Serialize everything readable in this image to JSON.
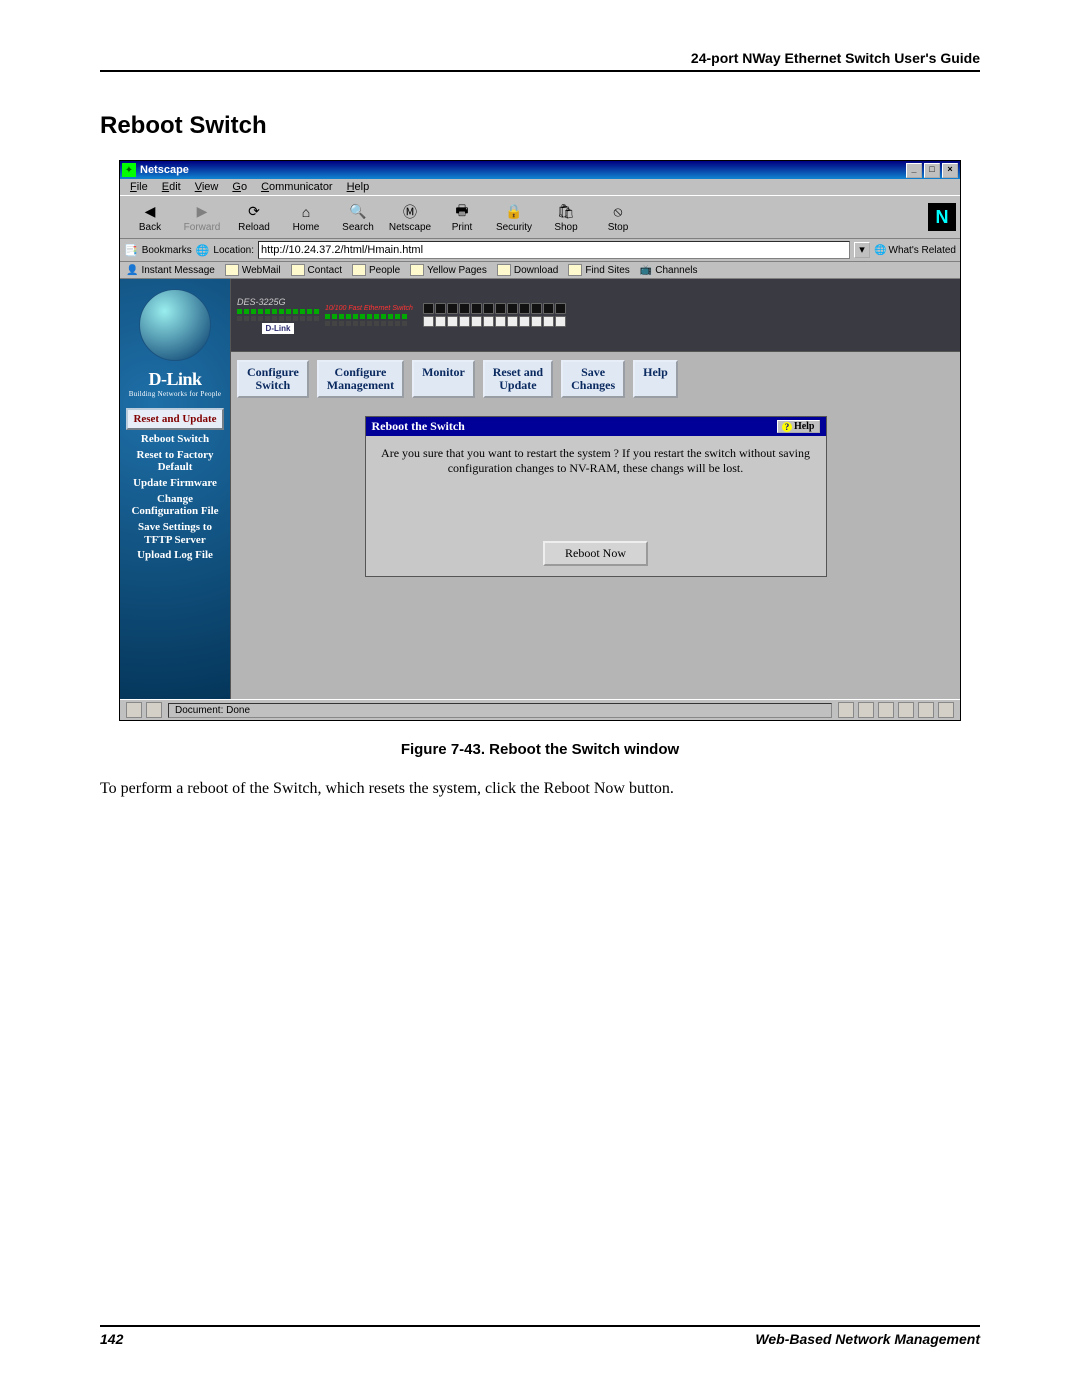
{
  "page_header": "24-port NWay Ethernet Switch User's Guide",
  "section_title": "Reboot Switch",
  "browser": {
    "title": "Netscape",
    "menu": [
      "File",
      "Edit",
      "View",
      "Go",
      "Communicator",
      "Help"
    ],
    "toolbar": {
      "back": "Back",
      "forward": "Forward",
      "reload": "Reload",
      "home": "Home",
      "search": "Search",
      "netscape": "Netscape",
      "print": "Print",
      "security": "Security",
      "shop": "Shop",
      "stop": "Stop"
    },
    "bookmarks_label": "Bookmarks",
    "location_label": "Location:",
    "location": "http://10.24.37.2/html/Hmain.html",
    "whats_related": "What's Related",
    "personal_toolbar": [
      "Instant Message",
      "WebMail",
      "Contact",
      "People",
      "Yellow Pages",
      "Download",
      "Find Sites",
      "Channels"
    ],
    "status": "Document: Done"
  },
  "device": {
    "model": "DES-3225G",
    "brand": "D-Link",
    "strip": "10/100 Fast Ethernet Switch"
  },
  "sidebar": {
    "brand": "D-Link",
    "tagline": "Building Networks for People",
    "active_btn": "Reset and Update",
    "links": [
      "Reboot Switch",
      "Reset to Factory Default",
      "Update Firmware",
      "Change Configuration File",
      "Save Settings to TFTP Server",
      "Upload Log File"
    ]
  },
  "tabs": [
    "Configure Switch",
    "Configure Management",
    "Monitor",
    "Reset and Update",
    "Save Changes",
    "Help"
  ],
  "panel": {
    "title": "Reboot the Switch",
    "help": "Help",
    "msg": "Are you sure that you want to restart the system ? If you restart the switch without saving configuration changes to NV-RAM, these changs will be lost.",
    "button": "Reboot Now"
  },
  "caption": "Figure 7-43.  Reboot the Switch window",
  "body_text": "To perform a reboot of the Switch, which resets the system, click the Reboot Now button.",
  "footer": {
    "page": "142",
    "section": "Web-Based Network Management"
  }
}
